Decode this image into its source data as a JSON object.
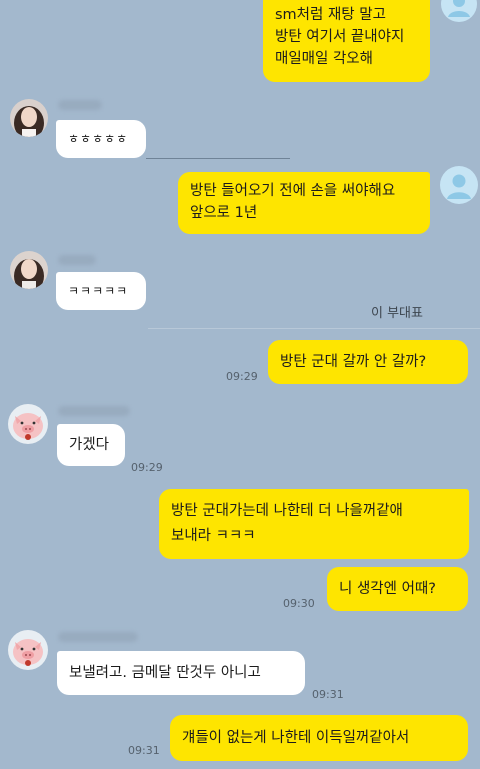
{
  "messages": [
    {
      "side": "me",
      "text": "sm처럼 재탕 말고\n방탄 여기서 끝내야지\n매일매일 각오해"
    },
    {
      "side": "them",
      "sender": "girl",
      "text": "ㅎㅎㅎㅎㅎ"
    },
    {
      "side": "me",
      "text": "방탄 들어오기 전에 손을 써야해요\n앞으로 1년"
    },
    {
      "side": "them",
      "sender": "girl",
      "text": "ㅋㅋㅋㅋㅋ"
    },
    {
      "side": "me",
      "text": "방탄 군대 갈까 안 갈까?",
      "time": "09:29"
    },
    {
      "side": "them",
      "sender": "pig",
      "text": "가겠다",
      "time": "09:29"
    },
    {
      "side": "me",
      "text": "방탄 군대가는데 나한테 더 나을꺼같애\n보내라 ㅋㅋㅋ"
    },
    {
      "side": "me",
      "text": "니 생각엔 어때?",
      "time": "09:30"
    },
    {
      "side": "them",
      "sender": "pig",
      "text": "보낼려고. 금메달 딴것두 아니고",
      "time": "09:31"
    },
    {
      "side": "me",
      "text": "걔들이 없는게 나한테 이득일꺼같아서",
      "time": "09:31"
    }
  ],
  "caption": "이 부대표",
  "colors": {
    "background": "#a3b8cd",
    "my_bubble": "#fee500",
    "their_bubble": "#ffffff"
  }
}
